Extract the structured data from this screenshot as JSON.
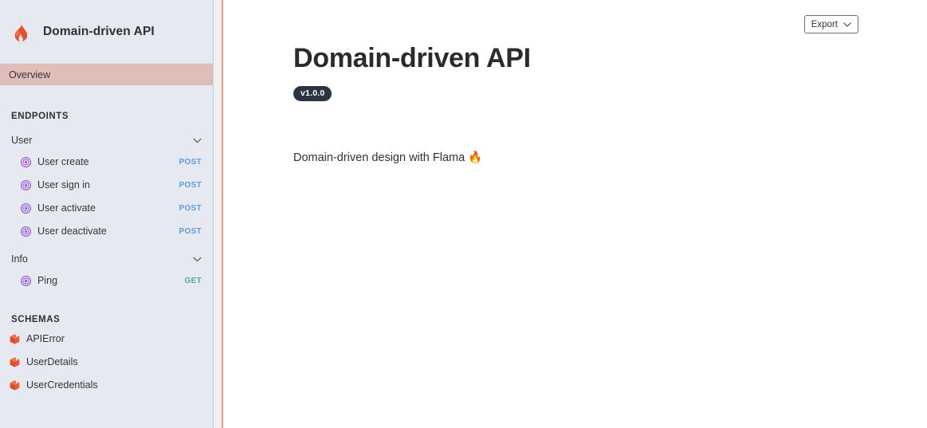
{
  "sidebar": {
    "logo_icon": "flame-icon",
    "title": "Domain-driven API",
    "overview_label": "Overview",
    "endpoints_label": "ENDPOINTS",
    "schemas_label": "SCHEMAS",
    "groups": [
      {
        "name": "User",
        "chevron_icon": "chevron-down-icon",
        "endpoints": [
          {
            "icon": "target-icon",
            "label": "User create",
            "method": "POST"
          },
          {
            "icon": "target-icon",
            "label": "User sign in",
            "method": "POST"
          },
          {
            "icon": "target-icon",
            "label": "User activate",
            "method": "POST"
          },
          {
            "icon": "target-icon",
            "label": "User deactivate",
            "method": "POST"
          }
        ]
      },
      {
        "name": "Info",
        "chevron_icon": "chevron-down-icon",
        "endpoints": [
          {
            "icon": "target-icon",
            "label": "Ping",
            "method": "GET"
          }
        ]
      }
    ],
    "schemas": [
      {
        "icon": "cube-icon",
        "label": "APIError"
      },
      {
        "icon": "cube-icon",
        "label": "UserDetails"
      },
      {
        "icon": "cube-icon",
        "label": "UserCredentials"
      }
    ]
  },
  "main": {
    "title": "Domain-driven API",
    "version": "v1.0.0",
    "description": "Domain-driven design with Flama 🔥",
    "export_label": "Export",
    "export_chevron_icon": "chevron-down-icon"
  },
  "colors": {
    "sidebar_bg": "#e7e9f2",
    "active_item_bg": "#e0bdb9",
    "accent_divider": "#e79a80",
    "flame_orange": "#e2512e",
    "endpoint_icon_purple": "#9a5ce0",
    "schema_icon_orange": "#e85a33",
    "method_post": "#5c9ce0",
    "method_get": "#4cb07a",
    "badge_bg": "#2b3440",
    "text_primary": "#2b2b2d"
  }
}
